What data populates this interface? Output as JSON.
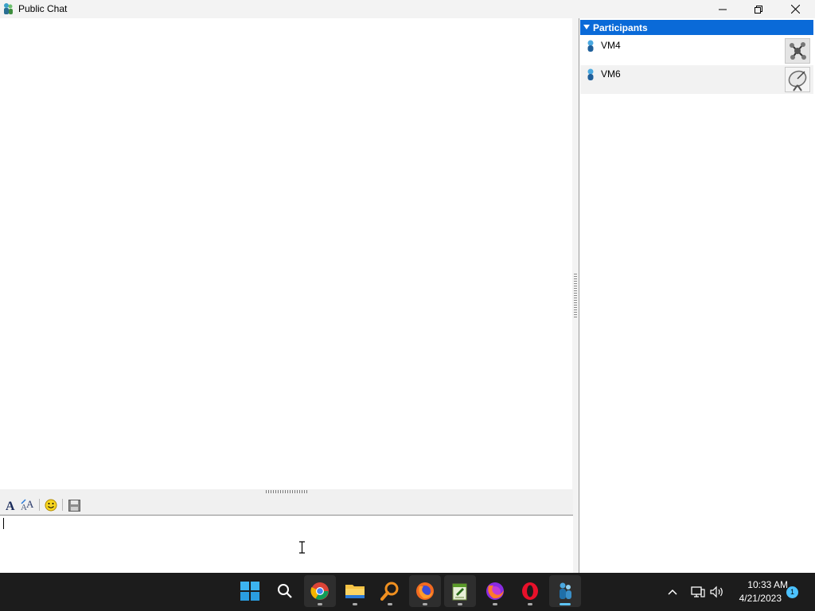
{
  "window": {
    "title": "Public Chat",
    "icon": "user-icon"
  },
  "title_buttons": [
    "minimize-icon",
    "restore-icon",
    "close-icon"
  ],
  "toolbar": {
    "items": [
      "font-icon",
      "font-color-icon",
      "smiley-icon",
      "save-icon"
    ]
  },
  "participants": {
    "header": "Participants",
    "list": [
      {
        "name": "VM4",
        "avatar": "molecule-avatar-icon"
      },
      {
        "name": "VM6",
        "avatar": "satellite-dish-avatar-icon"
      }
    ]
  },
  "taskbar": {
    "apps": [
      "start-icon",
      "search-icon",
      "chrome-icon",
      "file-explorer-icon",
      "search-app-icon",
      "firefox-icon",
      "notepad-icon",
      "firefox-nightly-icon",
      "opera-icon",
      "messenger-icon"
    ],
    "tray": [
      "chevron-up-icon",
      "network-icon",
      "volume-icon"
    ],
    "time": "10:33 AM",
    "date": "4/21/2023",
    "notification_count": "1"
  },
  "colors": {
    "accent": "#0a6ad8",
    "taskbar": "#1c1c1c",
    "active_indicator": "#5ec4f5"
  }
}
